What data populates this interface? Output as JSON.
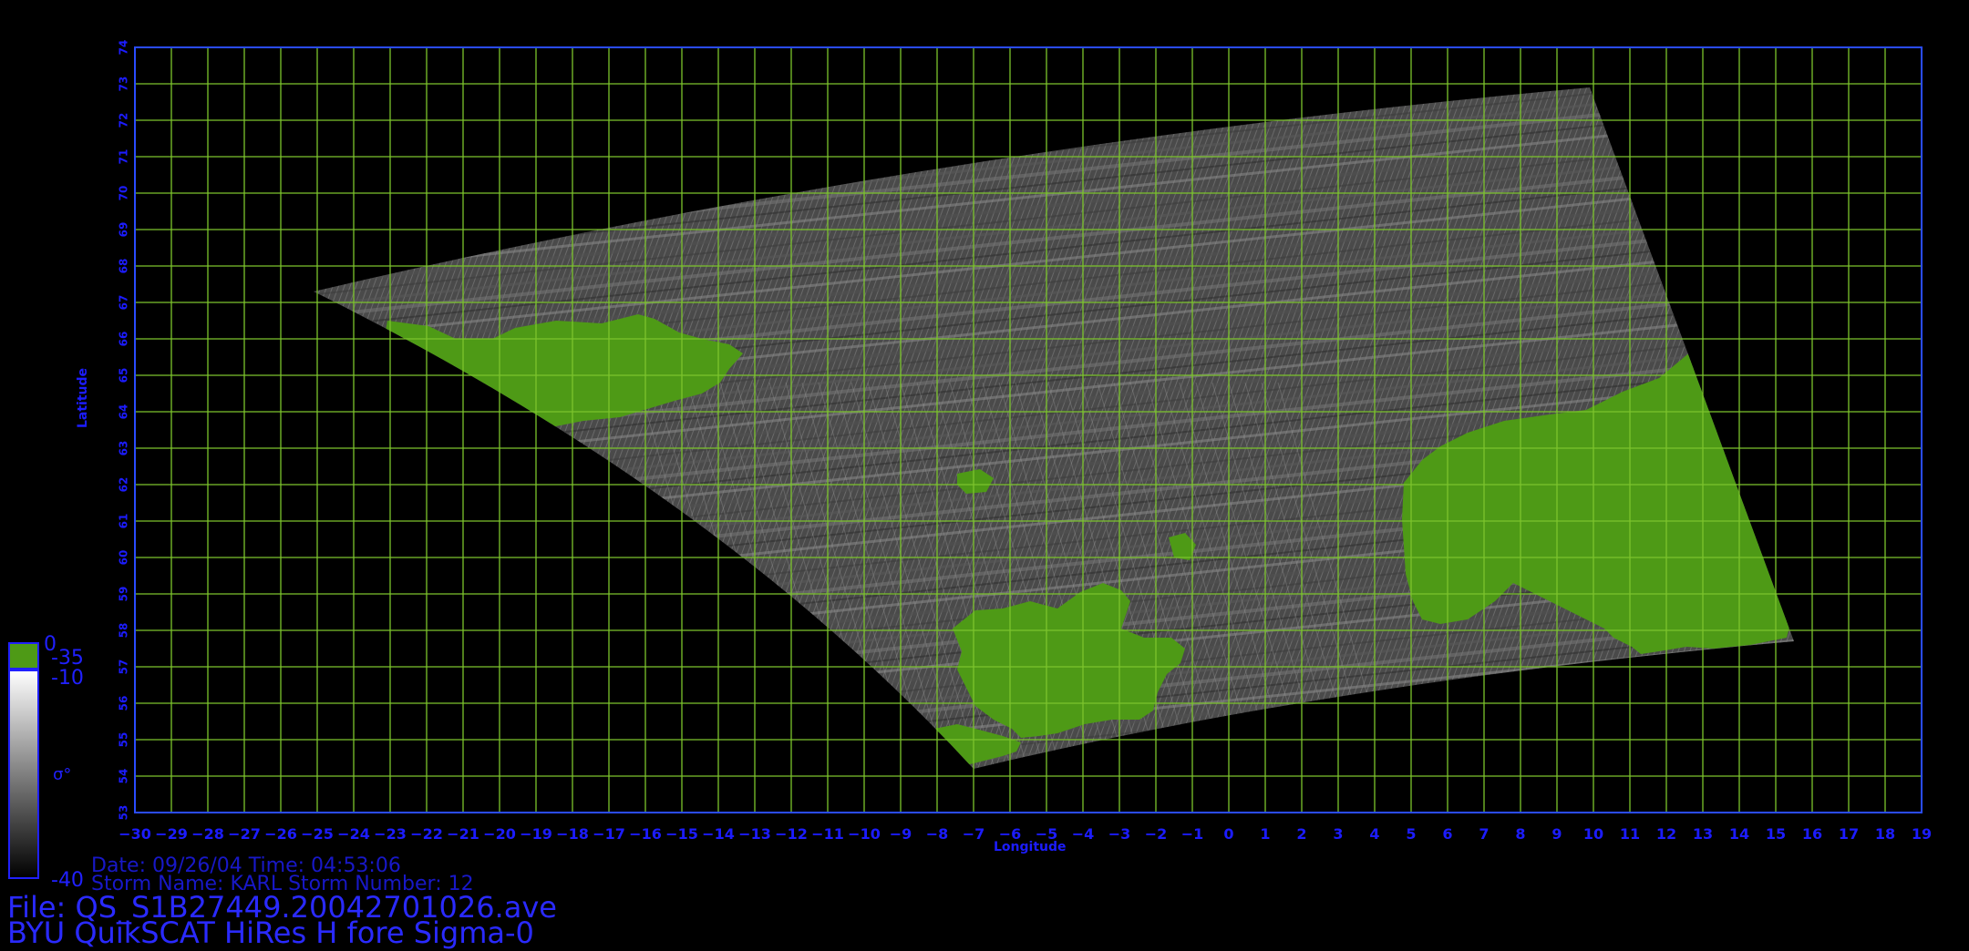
{
  "map": {
    "xticks": [
      -30,
      -29,
      -28,
      -27,
      -26,
      -25,
      -24,
      -23,
      -22,
      -21,
      -20,
      -19,
      -18,
      -17,
      -16,
      -15,
      -14,
      -13,
      -12,
      -11,
      -10,
      -9,
      -8,
      -7,
      -6,
      -5,
      -4,
      -3,
      -2,
      -1,
      0,
      1,
      2,
      3,
      4,
      5,
      6,
      7,
      8,
      9,
      10,
      11,
      12,
      13,
      14,
      15,
      16,
      17,
      18,
      19
    ],
    "yticks": [
      53,
      54,
      55,
      56,
      57,
      58,
      59,
      60,
      61,
      62,
      63,
      64,
      65,
      66,
      67,
      68,
      69,
      70,
      71,
      72,
      73,
      74
    ],
    "xlim": [
      -30,
      19
    ],
    "ylim": [
      53,
      74
    ],
    "xlabel": "Longitude",
    "ylabel": "Latitude",
    "grid": true,
    "swath_corners": [
      {
        "lon": -25.1,
        "lat": 67.3
      },
      {
        "lon": 9.9,
        "lat": 72.9
      },
      {
        "lon": 15.5,
        "lat": 57.7
      },
      {
        "lon": -7.0,
        "lat": 54.2
      }
    ],
    "land_masses": [
      "Iceland",
      "Faroe Islands",
      "Scotland",
      "Ireland",
      "Norway"
    ]
  },
  "colorbar": {
    "land_top": "0",
    "land_bottom": "-35",
    "ocean_max": "-10",
    "ocean_min": "-40",
    "symbol": "σ°"
  },
  "info": {
    "date_line": "Date: 09/26/04   Time: 04:53:06",
    "storm_line": "Storm  Name:  KARL   Storm  Number:  12",
    "file_line": "File:  QS_S1B27449.20042701026.ave",
    "product_line": "BYU  QuikSCAT  HiRes  H  fore  Sigma-0"
  },
  "colors": {
    "background": "#000000",
    "grid": "#7cc42c",
    "frame": "#2a4cff",
    "tick_labels": "#1c1cff",
    "land": "#4e9a16"
  }
}
